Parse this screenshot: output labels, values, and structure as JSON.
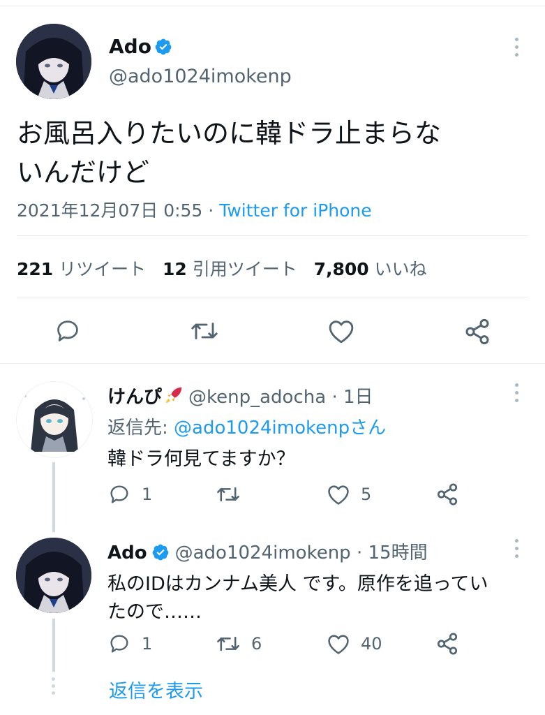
{
  "main_tweet": {
    "display_name": "Ado",
    "handle": "@ado1024imokenp",
    "text_line1": "お風呂入りたいのに韓ドラ止まらな",
    "text_line2": "いんだけど",
    "timestamp": "2021年12月07日 0:55 · ",
    "source": "Twitter for iPhone",
    "stats": {
      "retweets_count": "221",
      "retweets_label": "リツイート",
      "quotes_count": "12",
      "quotes_label": "引用ツイート",
      "likes_count": "7,800",
      "likes_label": "いいね"
    }
  },
  "replies": [
    {
      "display_name": "けんぴ",
      "handle_time": "@kenp_adocha · 1日",
      "reply_to_prefix": "返信先: ",
      "reply_to_handle": "@ado1024imokenpさん",
      "text": "韓ドラ何見てますか？",
      "reply_count": "1",
      "retweet_count": "",
      "like_count": "5"
    },
    {
      "display_name": "Ado",
      "handle_time": "@ado1024imokenp · 15時間",
      "text_line1": "私のIDはカンナム美人 です。原作を追ってい",
      "text_line2": "たので……",
      "reply_count": "1",
      "retweet_count": "6",
      "like_count": "40"
    }
  ],
  "show_replies_label": "返信を表示",
  "colors": {
    "accent": "#1d9bf0",
    "text": "#0f1419",
    "secondary": "#536471",
    "divider": "#e6ecf0"
  }
}
